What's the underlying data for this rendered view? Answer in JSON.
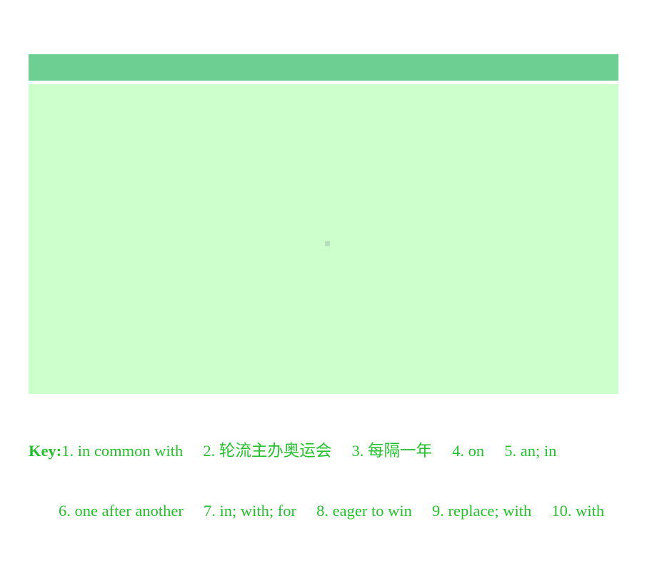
{
  "slide": {
    "title_placeholder": "",
    "body_placeholder": "",
    "background_color": "#ffffff",
    "title_bar_color": "#6ecf92",
    "content_panel_color": "#ccffcc",
    "answer_text_color": "#22c12b",
    "marker_color": "#b8ddbc"
  },
  "answer_key": {
    "label": "Key:",
    "line1": "1. in common with  2. 轮流主办奥运会  3. 每隔一年  4. on  5. an; in",
    "line2": "6. one after another  7. in; with; for  8. eager to win  9. replace; with  10. with",
    "items": [
      {
        "number": "1.",
        "answer": "in common with"
      },
      {
        "number": "2.",
        "answer": "轮流主办奥运会"
      },
      {
        "number": "3.",
        "answer": "每隔一年"
      },
      {
        "number": "4.",
        "answer": "on"
      },
      {
        "number": "5.",
        "answer": "an; in"
      },
      {
        "number": "6.",
        "answer": "one after another"
      },
      {
        "number": "7.",
        "answer": "in; with; for"
      },
      {
        "number": "8.",
        "answer": "eager to win"
      },
      {
        "number": "9.",
        "answer": "replace; with"
      },
      {
        "number": "10.",
        "answer": "with"
      }
    ]
  }
}
